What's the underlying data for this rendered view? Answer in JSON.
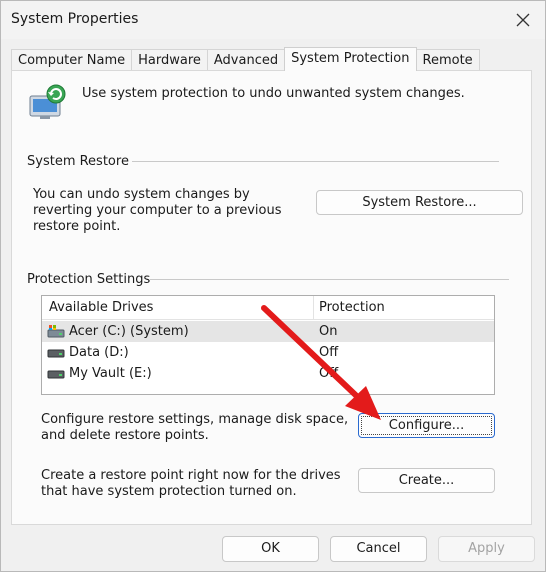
{
  "window": {
    "title": "System Properties"
  },
  "tabs": [
    {
      "label": "Computer Name"
    },
    {
      "label": "Hardware"
    },
    {
      "label": "Advanced"
    },
    {
      "label": "System Protection",
      "active": true
    },
    {
      "label": "Remote"
    }
  ],
  "intro": "Use system protection to undo unwanted system changes.",
  "system_restore": {
    "group_title": "System Restore",
    "description": "You can undo system changes by reverting your computer to a previous restore point.",
    "button_label": "System Restore..."
  },
  "protection": {
    "group_title": "Protection Settings",
    "columns": [
      "Available Drives",
      "Protection"
    ],
    "drives": [
      {
        "name": "Acer (C:) (System)",
        "protection": "On",
        "selected": true,
        "icon": "system-drive-icon"
      },
      {
        "name": "Data (D:)",
        "protection": "Off",
        "icon": "hard-drive-icon"
      },
      {
        "name": "My Vault (E:)",
        "protection": "Off",
        "icon": "hard-drive-icon"
      }
    ],
    "configure_desc": "Configure restore settings, manage disk space, and delete restore points.",
    "configure_label": "Configure...",
    "create_desc": "Create a restore point right now for the drives that have system protection turned on.",
    "create_label": "Create..."
  },
  "footer": {
    "ok": "OK",
    "cancel": "Cancel",
    "apply": "Apply"
  },
  "colors": {
    "arrow": "#e31b1b",
    "focus": "#2a6ad0",
    "selected_row": "#e5e5e5"
  }
}
